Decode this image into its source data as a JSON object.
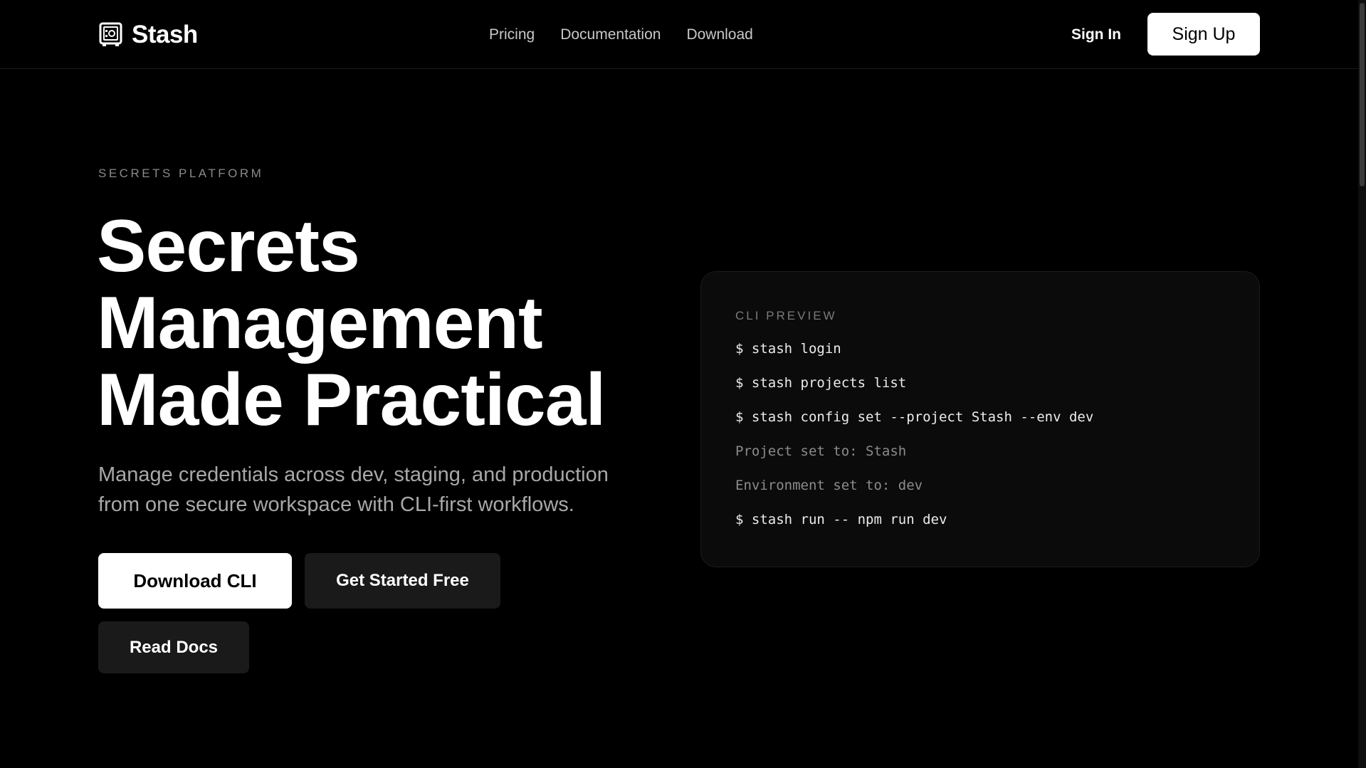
{
  "brand": {
    "name": "Stash",
    "logo_icon": "safe-icon"
  },
  "nav": {
    "items": [
      {
        "label": "Pricing"
      },
      {
        "label": "Documentation"
      },
      {
        "label": "Download"
      }
    ]
  },
  "auth": {
    "sign_in": "Sign In",
    "sign_up": "Sign Up"
  },
  "hero": {
    "eyebrow": "SECRETS PLATFORM",
    "headline_lines": [
      "Secrets",
      "Management",
      "Made Practical"
    ],
    "subheadline": "Manage credentials across dev, staging, and production from one secure workspace with CLI-first workflows.",
    "buttons": {
      "download": "Download CLI",
      "get_started": "Get Started Free",
      "read_docs": "Read Docs"
    }
  },
  "cli_preview": {
    "title": "CLI PREVIEW",
    "lines": [
      {
        "text": "$ stash login",
        "kind": "command"
      },
      {
        "text": "$ stash projects list",
        "kind": "command"
      },
      {
        "text": "$ stash config set --project Stash --env dev",
        "kind": "command"
      },
      {
        "text": "Project set to: Stash",
        "kind": "output"
      },
      {
        "text": "Environment set to: dev",
        "kind": "output"
      },
      {
        "text": "$ stash run -- npm run dev",
        "kind": "command"
      }
    ]
  },
  "colors": {
    "background": "#000000",
    "card": "#0b0b0b",
    "primary_button": "#ffffff",
    "secondary_button": "#1a1a1a",
    "muted_text": "#a8a8a8"
  }
}
